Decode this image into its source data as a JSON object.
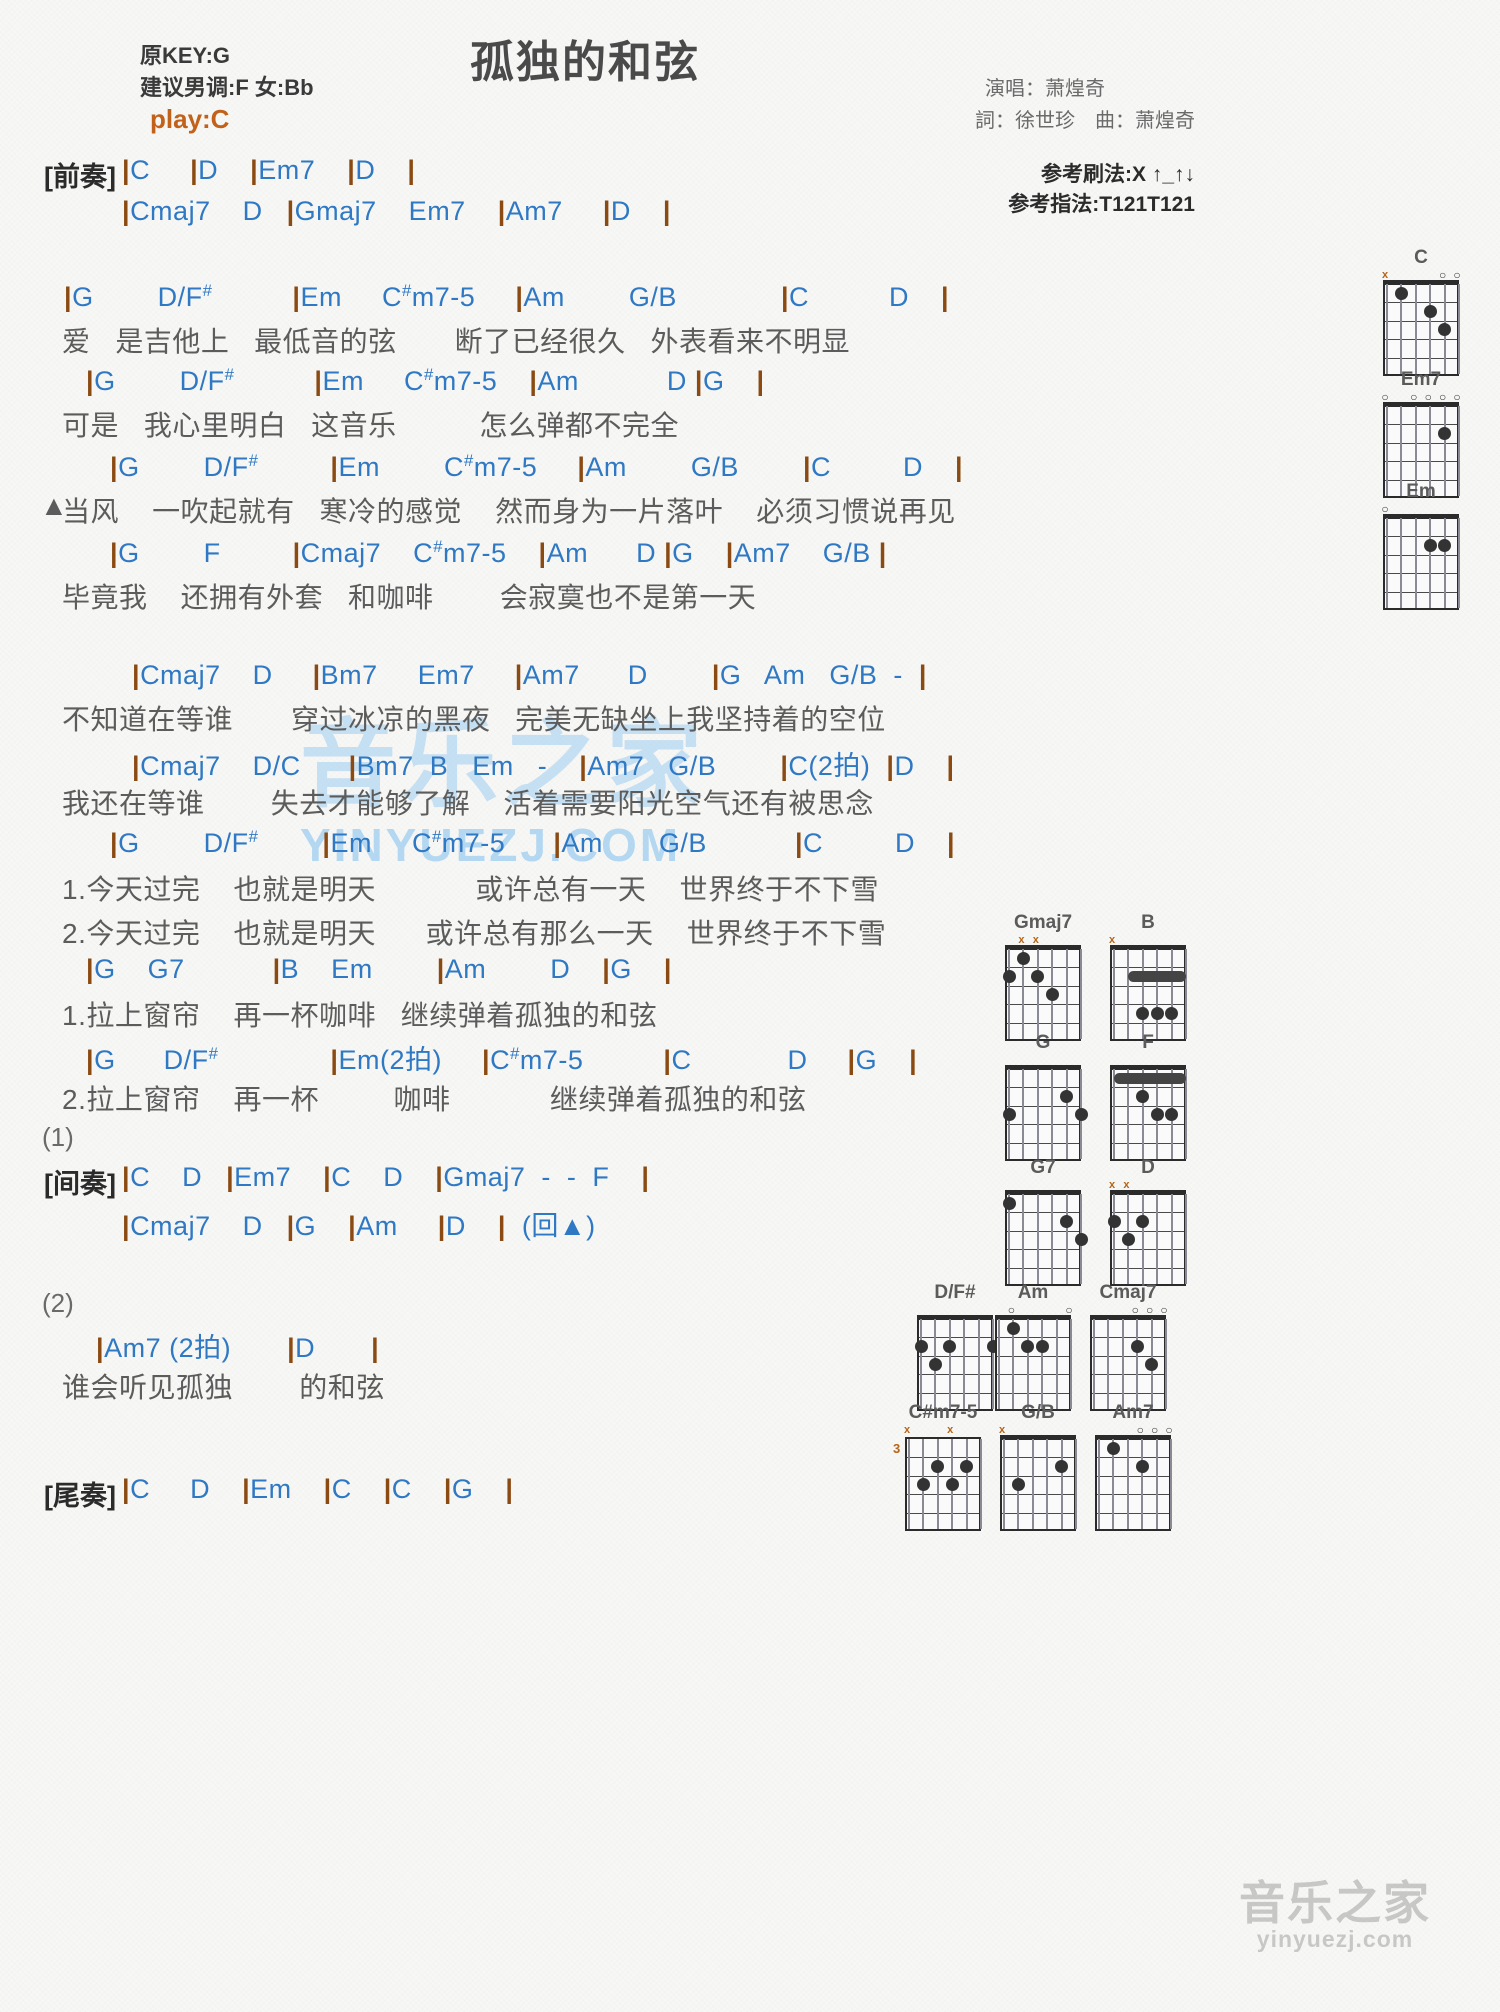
{
  "header": {
    "orig_key": "原KEY:G",
    "suggest_key": "建议男调:F 女:Bb",
    "play_key": "play:C",
    "title": "孤独的和弦",
    "singer": "演唱：萧煌奇",
    "writer": "詞：徐世珍　曲：萧煌奇",
    "strum_pattern": "参考刷法:X ↑_↑↓",
    "finger_pattern": "参考指法:T121T121",
    "accent_color": "#c2621a",
    "chord_color": "#2f78c4",
    "bar_color": "#8a4a12"
  },
  "watermark": {
    "main_cn": "音乐之家",
    "main_url": "YINYUEZJ.COM",
    "bottom_cn": "音乐之家",
    "bottom_url": "yinyuezj.com"
  },
  "sections": {
    "intro_label": "[前奏]",
    "interlude_label": "[间奏]",
    "outro_label": "[尾奏]",
    "mark_1": "(1)",
    "mark_2": "(2)",
    "triangle": "▲"
  },
  "lines": {
    "intro_1": "|C     |D    |Em7    |D    |",
    "intro_2": "|Cmaj7    D   |Gmaj7    Em7    |Am7     |D    |",
    "v1_c1": "|G        D/F#          |Em     C#m7-5     |Am        G/B             |C          D    |",
    "v1_l1": "爱   是吉他上   最低音的弦       断了已经很久   外表看来不明显",
    "v1_c2": "|G        D/F#          |Em     C#m7-5    |Am           D |G    |",
    "v1_l2": "可是   我心里明白   这音乐          怎么弹都不完全",
    "v1_c3": "|G        D/F#         |Em        C#m7-5     |Am        G/B        |C         D    |",
    "v1_l3": "当风    一吹起就有   寒冷的感觉    然而身为一片落叶    必须习惯说再见",
    "v1_c4": "|G        F         |Cmaj7    C#m7-5    |Am      D |G    |Am7    G/B |",
    "v1_l4": "毕竟我    还拥有外套   和咖啡        会寂寞也不是第一天",
    "ch_c1": "|Cmaj7    D     |Bm7     Em7     |Am7      D        |G   Am   G/B  -  |",
    "ch_l1": "不知道在等谁       穿过冰凉的黑夜   完美无缺坐上我坚持着的空位",
    "ch_c2": "|Cmaj7    D/C      |Bm7  B   Em   -    |Am7   G/B        |C(2拍)  |D    |",
    "ch_l2": "我还在等谁        失去才能够了解    活着需要阳光空气还有被思念",
    "ch_c3": "|G        D/F#        |Em     C#m7-5      |Am       G/B           |C         D    |",
    "ch_l3a": "1.今天过完    也就是明天            或许总有一天    世界终于不下雪",
    "ch_l3b": "2.今天过完    也就是明天      或许总有那么一天    世界终于不下雪",
    "ch_c4": "|G    G7           |B    Em        |Am        D    |G    |",
    "ch_l4": "1.拉上窗帘    再一杯咖啡   继续弹着孤独的和弦",
    "ch_c5": "|G      D/F#              |Em(2拍)     |C#m7-5          |C            D     |G    |",
    "ch_l5": "2.拉上窗帘    再一杯         咖啡            继续弹着孤独的和弦",
    "inter_1": "|C    D   |Em7    |C    D    |Gmaj7  -  -  F    |",
    "inter_2": "|Cmaj7    D   |G    |Am     |D    |  (回▲)",
    "end_c1": "|Am7 (2拍)       |D       |",
    "end_l1": "谁会听见孤独        的和弦",
    "outro_1": "|C     D    |Em    |C    |C    |G    |"
  },
  "chord_diagrams": [
    {
      "name": "C",
      "markers": [
        "x",
        "",
        "",
        "",
        "o",
        "o"
      ],
      "dots": [
        {
          "s": 2,
          "f": 1
        },
        {
          "s": 4,
          "f": 2
        },
        {
          "s": 5,
          "f": 3
        }
      ],
      "barre": null,
      "fret_start": ""
    },
    {
      "name": "Em7",
      "markers": [
        "o",
        "",
        "o",
        "o",
        "o",
        "o"
      ],
      "dots": [
        {
          "s": 5,
          "f": 2
        }
      ],
      "barre": null,
      "fret_start": ""
    },
    {
      "name": "Em",
      "markers": [
        "o",
        "",
        "",
        "",
        "",
        ""
      ],
      "dots": [
        {
          "s": 5,
          "f": 2
        },
        {
          "s": 4,
          "f": 2
        }
      ],
      "barre": null,
      "fret_start": ""
    },
    {
      "name": "Gmaj7",
      "markers": [
        "",
        "x",
        "x",
        "",
        "",
        ""
      ],
      "dots": [
        {
          "s": 1,
          "f": 2
        },
        {
          "s": 2,
          "f": 1
        },
        {
          "s": 3,
          "f": 2
        },
        {
          "s": 4,
          "f": 3
        }
      ],
      "barre": null,
      "fret_start": ""
    },
    {
      "name": "B",
      "markers": [
        "x",
        "",
        "",
        "",
        "",
        ""
      ],
      "dots": [
        {
          "s": 3,
          "f": 4
        },
        {
          "s": 4,
          "f": 4
        },
        {
          "s": 5,
          "f": 4
        }
      ],
      "barre": {
        "f": 2,
        "from": 2,
        "to": 6
      },
      "fret_start": ""
    },
    {
      "name": "G",
      "markers": [
        "",
        "",
        "",
        "",
        "",
        ""
      ],
      "dots": [
        {
          "s": 6,
          "f": 3
        },
        {
          "s": 5,
          "f": 2
        },
        {
          "s": 1,
          "f": 3
        }
      ],
      "barre": null,
      "fret_start": ""
    },
    {
      "name": "F",
      "markers": [
        "",
        "",
        "",
        "",
        "",
        ""
      ],
      "dots": [
        {
          "s": 3,
          "f": 2
        },
        {
          "s": 4,
          "f": 3
        },
        {
          "s": 5,
          "f": 3
        }
      ],
      "barre": {
        "f": 1,
        "from": 1,
        "to": 6
      },
      "fret_start": ""
    },
    {
      "name": "G7",
      "markers": [
        "",
        "",
        "",
        "",
        "",
        ""
      ],
      "dots": [
        {
          "s": 6,
          "f": 3
        },
        {
          "s": 5,
          "f": 2
        },
        {
          "s": 1,
          "f": 1
        }
      ],
      "barre": null,
      "fret_start": ""
    },
    {
      "name": "D",
      "markers": [
        "x",
        "x",
        "",
        "",
        "",
        ""
      ],
      "dots": [
        {
          "s": 3,
          "f": 2
        },
        {
          "s": 1,
          "f": 2
        },
        {
          "s": 2,
          "f": 3
        }
      ],
      "barre": null,
      "fret_start": ""
    },
    {
      "name": "D/F#",
      "markers": [
        "",
        "",
        "",
        "",
        "",
        ""
      ],
      "dots": [
        {
          "s": 6,
          "f": 2
        },
        {
          "s": 3,
          "f": 2
        },
        {
          "s": 1,
          "f": 2
        },
        {
          "s": 2,
          "f": 3
        }
      ],
      "barre": null,
      "fret_start": ""
    },
    {
      "name": "Am",
      "markers": [
        "",
        "o",
        "",
        "",
        "",
        "o"
      ],
      "dots": [
        {
          "s": 4,
          "f": 2
        },
        {
          "s": 3,
          "f": 2
        },
        {
          "s": 2,
          "f": 1
        }
      ],
      "barre": null,
      "fret_start": ""
    },
    {
      "name": "Cmaj7",
      "markers": [
        "",
        "",
        "",
        "o",
        "o",
        "o"
      ],
      "dots": [
        {
          "s": 4,
          "f": 2
        },
        {
          "s": 5,
          "f": 3
        }
      ],
      "barre": null,
      "fret_start": ""
    },
    {
      "name": "C#m7-5",
      "markers": [
        "x",
        "",
        "",
        "x",
        "",
        ""
      ],
      "dots": [
        {
          "s": 5,
          "f": 2
        },
        {
          "s": 3,
          "f": 2
        },
        {
          "s": 4,
          "f": 3
        },
        {
          "s": 2,
          "f": 3
        }
      ],
      "barre": null,
      "fret_start": "3"
    },
    {
      "name": "G/B",
      "markers": [
        "x",
        "",
        "",
        "",
        "",
        ""
      ],
      "dots": [
        {
          "s": 5,
          "f": 2
        },
        {
          "s": 2,
          "f": 3
        }
      ],
      "barre": null,
      "fret_start": ""
    },
    {
      "name": "Am7",
      "markers": [
        "",
        "",
        "",
        "o",
        "o",
        "o"
      ],
      "dots": [
        {
          "s": 2,
          "f": 1
        },
        {
          "s": 4,
          "f": 2
        }
      ],
      "barre": null,
      "fret_start": ""
    }
  ]
}
